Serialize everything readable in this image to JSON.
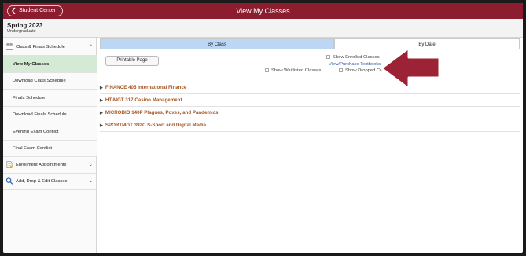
{
  "header": {
    "back_label": "Student Center",
    "title": "View My Classes"
  },
  "term": {
    "name": "Spring 2023",
    "career": "Undergraduate"
  },
  "sidebar": {
    "groups": [
      {
        "label": "Class & Finals Schedule",
        "icon": "calendar-icon",
        "expanded": true,
        "items": [
          {
            "label": "View My Classes",
            "active": true
          },
          {
            "label": "Download Class Schedule"
          },
          {
            "label": "Finals Schedule"
          },
          {
            "label": "Download Finals Schedule"
          },
          {
            "label": "Evening Exam Conflict"
          },
          {
            "label": "Final Exam Conflict"
          }
        ]
      },
      {
        "label": "Enrollment Appointments",
        "icon": "document-icon",
        "expanded": false
      },
      {
        "label": "Add, Drop & Edit Classes",
        "icon": "search-icon",
        "expanded": false
      }
    ]
  },
  "tabs": [
    {
      "label": "By Class",
      "selected": true
    },
    {
      "label": "By Date",
      "selected": false
    }
  ],
  "toolbar": {
    "printable_label": "Printable Page",
    "show_enrolled_label": "Show Enrolled Classes",
    "textbooks_link": "View/Purchase Textbooks",
    "show_waitlisted_label": "Show Waitlisted Classes",
    "show_dropped_label": "Show Dropped Classes"
  },
  "courses": [
    {
      "label": "FINANCE 405 International Finance"
    },
    {
      "label": "HT-MGT 317 Casino Management"
    },
    {
      "label": "MICROBIO 140P Plagues, Poxes, and Pandemics"
    },
    {
      "label": "SPORTMGT 392C S-Sport and Digital Media"
    }
  ],
  "colors": {
    "header_maroon": "#8c1d2e",
    "active_tab_blue": "#bcd6f6",
    "active_nav_green": "#d5ead5",
    "course_link": "#a65523",
    "annotation_arrow": "#9b2335"
  }
}
